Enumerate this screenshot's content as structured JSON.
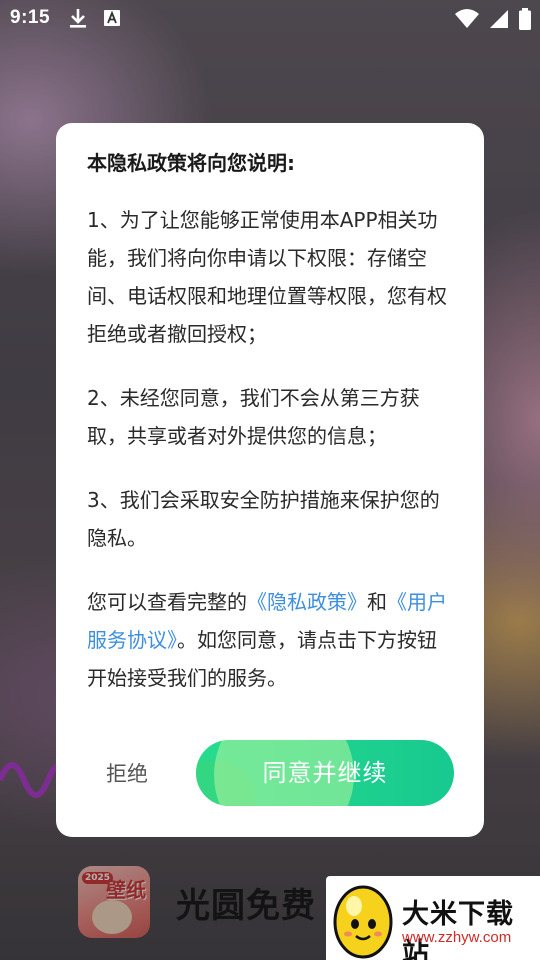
{
  "status_bar": {
    "time": "9:15",
    "icons_left": [
      "download-icon",
      "a-box-icon"
    ],
    "icons_right": [
      "wifi-icon",
      "signal-icon",
      "battery-icon"
    ]
  },
  "background_app": {
    "name": "光圆免费",
    "logo_badge": "2025",
    "logo_text": "壁纸"
  },
  "dialog": {
    "title": "本隐私政策将向您说明:",
    "p1": "1、为了让您能够正常使用本APP相关功能，我们将向你申请以下权限：存储空间、电话权限和地理位置等权限，您有权拒绝或者撤回授权；",
    "p2": "2、未经您同意，我们不会从第三方获取，共享或者对外提供您的信息；",
    "p3": "3、我们会采取安全防护措施来保护您的隐私。",
    "p4": {
      "before": "您可以查看完整的",
      "privacy_link": "《隐私政策》",
      "and": "和",
      "terms_link": "《用户服务协议》",
      "after": "。如您同意，请点击下方按钮开始接受我们的服务。"
    },
    "decline_label": "拒绝",
    "accept_label": "同意并继续"
  },
  "watermark": {
    "title": "大米下载站",
    "url": "www.zzhyw.com"
  },
  "colors": {
    "accent_green": "#1fd38f",
    "link_blue": "#3e8fe0",
    "watermark_red": "#d22a2a"
  }
}
